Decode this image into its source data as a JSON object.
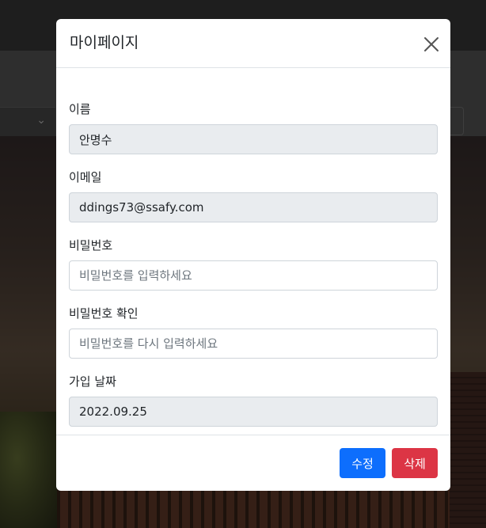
{
  "modal": {
    "title": "마이페이지",
    "close_icon": "close-icon"
  },
  "fields": {
    "name": {
      "label": "이름",
      "value": "안명수"
    },
    "email": {
      "label": "이메일",
      "value": "ddings73@ssafy.com"
    },
    "password": {
      "label": "비밀번호",
      "placeholder": "비밀번호를 입력하세요"
    },
    "password_confirm": {
      "label": "비밀번호 확인",
      "placeholder": "비밀번호를 다시 입력하세요"
    },
    "join_date": {
      "label": "가입 날짜",
      "value": "2022.09.25"
    }
  },
  "footer": {
    "edit_label": "수정",
    "delete_label": "삭제"
  },
  "colors": {
    "primary": "#0d6efd",
    "danger": "#dc3545",
    "readonly_bg": "#e9ecef",
    "border": "#ced4da"
  },
  "background": {
    "select_chevron_icon": "chevron-down-icon"
  }
}
